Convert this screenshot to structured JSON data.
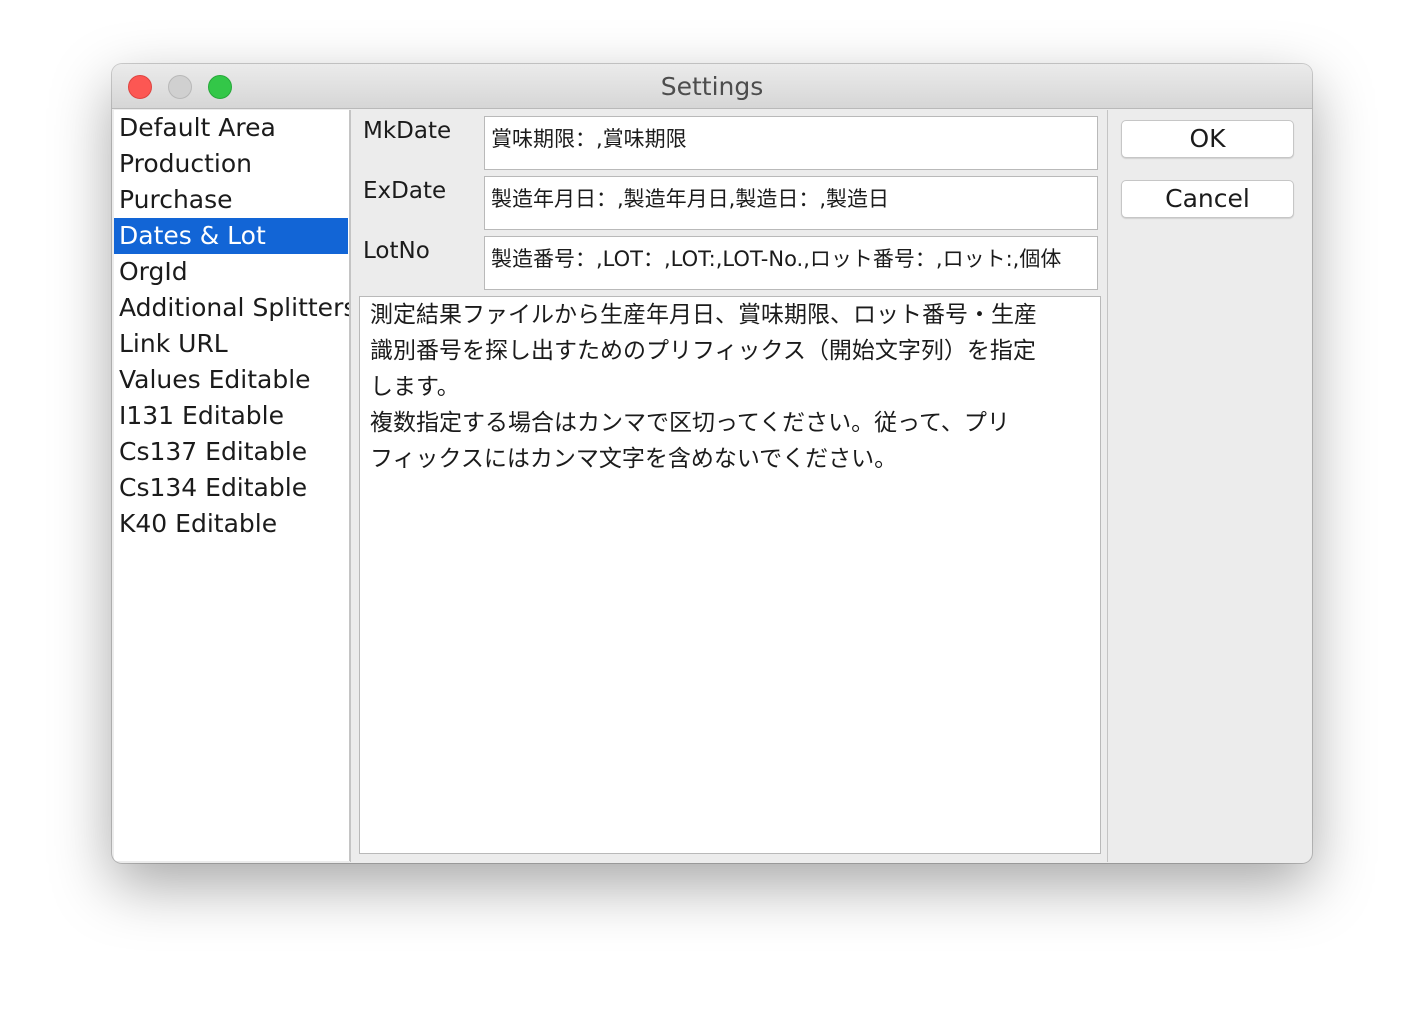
{
  "window": {
    "title": "Settings"
  },
  "sidebar": {
    "items": [
      {
        "label": "Default Area",
        "selected": false
      },
      {
        "label": "Production",
        "selected": false
      },
      {
        "label": "Purchase",
        "selected": false
      },
      {
        "label": "Dates & Lot",
        "selected": true
      },
      {
        "label": "OrgId",
        "selected": false
      },
      {
        "label": "Additional Splitters",
        "selected": false
      },
      {
        "label": "Link URL",
        "selected": false
      },
      {
        "label": "Values Editable",
        "selected": false
      },
      {
        "label": "I131 Editable",
        "selected": false
      },
      {
        "label": "Cs137 Editable",
        "selected": false
      },
      {
        "label": "Cs134 Editable",
        "selected": false
      },
      {
        "label": "K40 Editable",
        "selected": false
      }
    ]
  },
  "fields": {
    "mkdate": {
      "label": "MkDate",
      "value": "賞味期限：,賞味期限"
    },
    "exdate": {
      "label": "ExDate",
      "value": "製造年月日：,製造年月日,製造日：,製造日"
    },
    "lotno": {
      "label": "LotNo",
      "value": "製造番号：,LOT：,LOT:,LOT-No.,ロット番号：,ロット:,個体"
    }
  },
  "description": "測定結果ファイルから生産年月日、賞味期限、ロット番号・生産\n識別番号を探し出すためのプリフィックス（開始文字列）を指定\nします。\n複数指定する場合はカンマで区切ってください。従って、プリ\nフィックスにはカンマ文字を含めないでください。",
  "buttons": {
    "ok": "OK",
    "cancel": "Cancel"
  },
  "colors": {
    "selection": "#1265d6",
    "close": "#fc5753",
    "minimize": "#d0d0d0",
    "zoom": "#33c748"
  }
}
